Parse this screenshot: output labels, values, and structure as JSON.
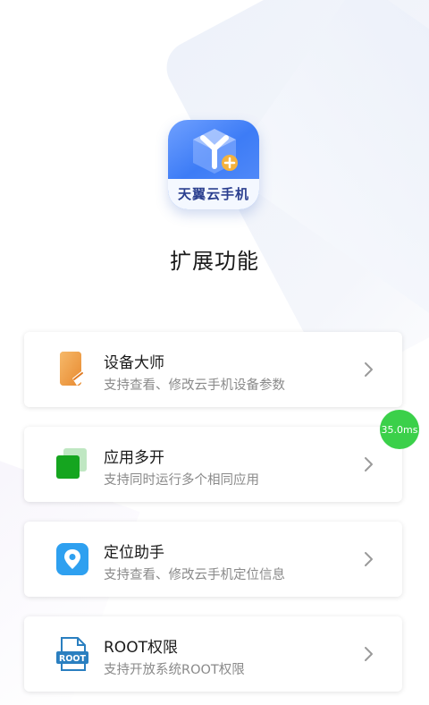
{
  "header": {
    "logo_text": "天翼云手机",
    "page_title": "扩展功能"
  },
  "features": [
    {
      "title": "设备大师",
      "desc": "支持查看、修改云手机设备参数",
      "icon": "device-master-icon"
    },
    {
      "title": "应用多开",
      "desc": "支持同时运行多个相同应用",
      "icon": "multi-app-icon"
    },
    {
      "title": "定位助手",
      "desc": "支持查看、修改云手机定位信息",
      "icon": "location-icon"
    },
    {
      "title": "ROOT权限",
      "desc": "支持开放系统ROOT权限",
      "icon": "root-file-icon",
      "icon_text": "ROOT"
    }
  ],
  "overlay": {
    "timer": "35.0ms"
  },
  "colors": {
    "logo_blue": "#3d7cf6",
    "device_orange": "#f0a04a",
    "multi_green": "#15a51f",
    "location_blue": "#2ea0f0",
    "root_blue": "#2a7fc0",
    "timer_green": "#3bd04a"
  }
}
